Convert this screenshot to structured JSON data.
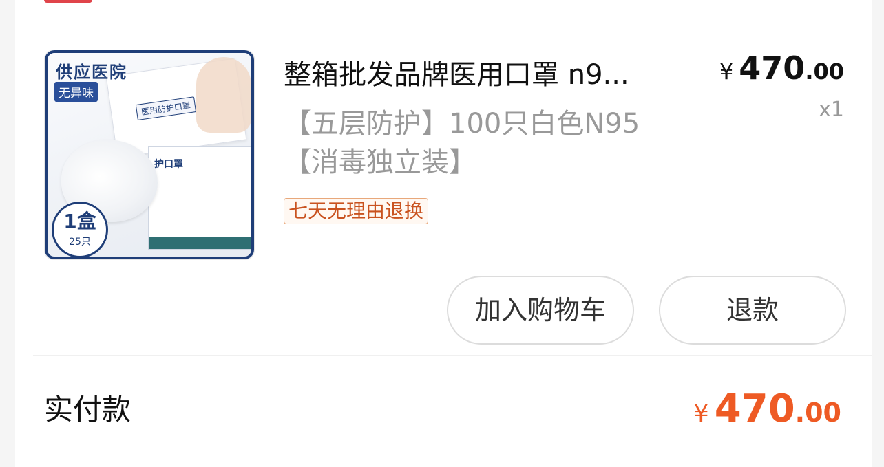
{
  "product": {
    "title": "整箱批发品牌医用口罩 n9...",
    "sku": "【五层防护】100只白色N95【消毒独立装】",
    "service_tag": "七天无理由退换",
    "quantity": "x1",
    "price": {
      "currency": "¥",
      "int": "470",
      "dec": ".00"
    },
    "image": {
      "brand_text": "供应医院",
      "tag_text": "无异味",
      "envelope_label": "医用防护口罩",
      "box_label": "护口罩",
      "badge_big": "1盒",
      "badge_small": "25只"
    }
  },
  "actions": {
    "add_to_cart": "加入购物车",
    "refund": "退款"
  },
  "summary": {
    "paid_label": "实付款",
    "paid_amount": {
      "currency": "¥",
      "int": "470",
      "dec": ".00"
    }
  },
  "colors": {
    "accent": "#ee5a24",
    "service_border": "#e8a87b",
    "text_secondary": "#999999"
  }
}
